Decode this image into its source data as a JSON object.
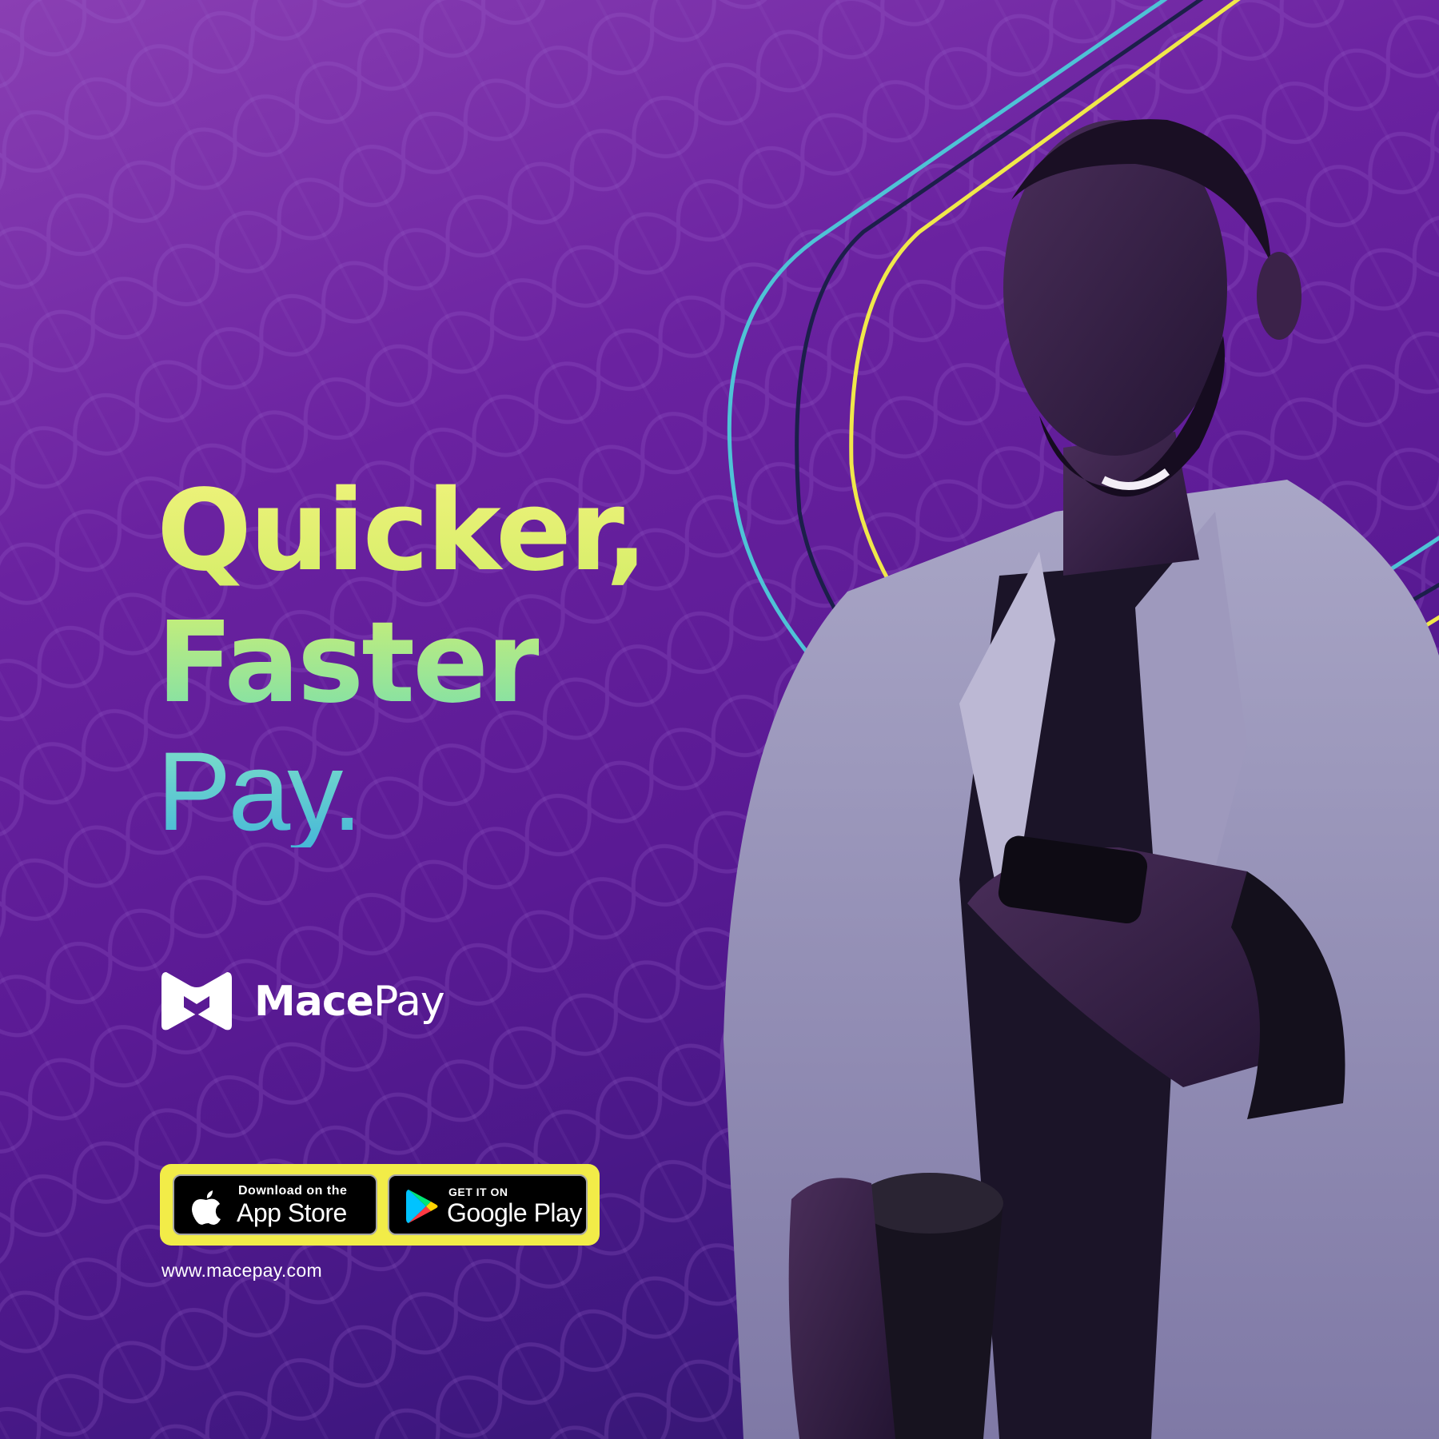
{
  "headline": {
    "line1": "Quicker,",
    "line2": "Faster",
    "line3": "Pay."
  },
  "brand": {
    "name_bold": "Mace",
    "name_light": "Pay",
    "logo_icon": "macepay-logo-icon"
  },
  "stores": {
    "appstore": {
      "small": "Download on the",
      "big": "App Store",
      "icon": "apple-icon"
    },
    "googleplay": {
      "small": "GET IT ON",
      "big": "Google Play",
      "icon": "google-play-icon"
    }
  },
  "website": "www.macepay.com",
  "colors": {
    "background_top": "#8a3fb3",
    "background_bottom": "#2a1763",
    "headline_yellow": "#eef27a",
    "headline_green": "#7fe0a8",
    "headline_blue": "#46b8d8",
    "store_panel": "#f2ec48",
    "line_cyan": "#4ec3d6",
    "line_navy": "#1c1f4a",
    "line_yellow": "#f0e84a"
  }
}
